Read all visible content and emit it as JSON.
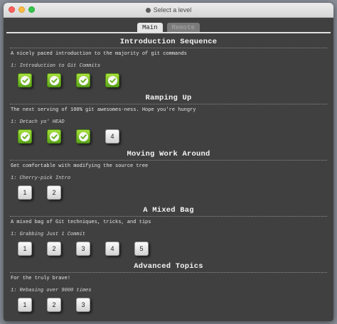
{
  "window": {
    "title": "Select a level"
  },
  "tabs": [
    {
      "label": "Main",
      "active": true
    },
    {
      "label": "Remote",
      "active": false
    }
  ],
  "sequences": [
    {
      "title": "Introduction Sequence",
      "about": "A nicely paced introduction to the majority of git commands",
      "level_name": "1: Introduction to Git Commits",
      "levels": [
        {
          "label": "1",
          "completed": true
        },
        {
          "label": "2",
          "completed": true
        },
        {
          "label": "3",
          "completed": true
        },
        {
          "label": "4",
          "completed": true
        }
      ]
    },
    {
      "title": "Ramping Up",
      "about": "The next serving of 100% git awesomes-ness. Hope you're hungry",
      "level_name": "1: Detach yo' HEAD",
      "levels": [
        {
          "label": "1",
          "completed": true
        },
        {
          "label": "2",
          "completed": true
        },
        {
          "label": "3",
          "completed": true
        },
        {
          "label": "4",
          "completed": false
        }
      ]
    },
    {
      "title": "Moving Work Around",
      "about": "Get comfortable with modifying the source tree",
      "level_name": "1: Cherry-pick Intro",
      "levels": [
        {
          "label": "1",
          "completed": false
        },
        {
          "label": "2",
          "completed": false
        }
      ]
    },
    {
      "title": "A Mixed Bag",
      "about": "A mixed bag of Git techniques, tricks, and tips",
      "level_name": "1: Grabbing Just 1 Commit",
      "levels": [
        {
          "label": "1",
          "completed": false
        },
        {
          "label": "2",
          "completed": false
        },
        {
          "label": "3",
          "completed": false
        },
        {
          "label": "4",
          "completed": false
        },
        {
          "label": "5",
          "completed": false
        }
      ]
    },
    {
      "title": "Advanced Topics",
      "about": "For the truly brave!",
      "level_name": "1: Rebasing over 9000 times",
      "levels": [
        {
          "label": "1",
          "completed": false
        },
        {
          "label": "2",
          "completed": false
        },
        {
          "label": "3",
          "completed": false
        }
      ]
    }
  ],
  "icons": {
    "completed": "checkmark-icon",
    "title": "gear-icon"
  },
  "colors": {
    "completed_green": "#7cc22a",
    "background": "#404040"
  }
}
